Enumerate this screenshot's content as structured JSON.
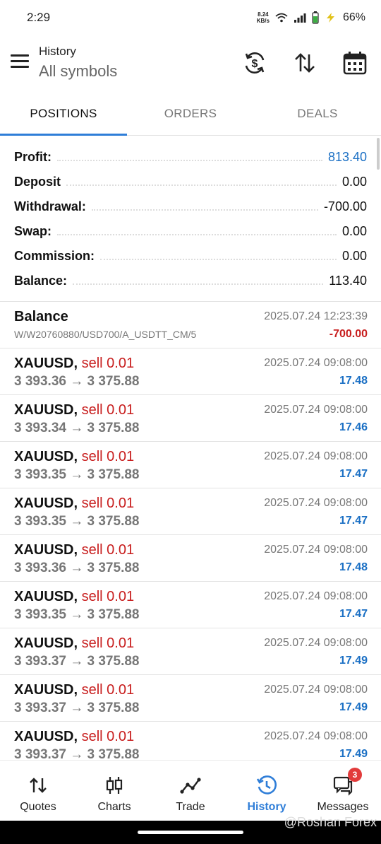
{
  "status_bar": {
    "time": "2:29",
    "net_speed_value": "8.24",
    "net_speed_unit": "KB/s",
    "battery": "66%"
  },
  "header": {
    "subtitle": "History",
    "title": "All symbols"
  },
  "tabs": [
    {
      "label": "POSITIONS",
      "active": true
    },
    {
      "label": "ORDERS",
      "active": false
    },
    {
      "label": "DEALS",
      "active": false
    }
  ],
  "summary": [
    {
      "label": "Profit:",
      "value": "813.40",
      "color": "#1a6fc4"
    },
    {
      "label": "Deposit",
      "value": "0.00"
    },
    {
      "label": "Withdrawal:",
      "value": "-700.00"
    },
    {
      "label": "Swap:",
      "value": "0.00"
    },
    {
      "label": "Commission:",
      "value": "0.00"
    },
    {
      "label": "Balance:",
      "value": "113.40"
    }
  ],
  "balance_entry": {
    "title": "Balance",
    "comment": "W/W20760880/USD700/A_USDTT_CM/5",
    "time": "2025.07.24 12:23:39",
    "amount": "-700.00"
  },
  "positions": [
    {
      "symbol": "XAUUSD,",
      "op": "sell 0.01",
      "prices": "3 393.36 → 3 375.88",
      "time": "2025.07.24 09:08:00",
      "profit": "17.48"
    },
    {
      "symbol": "XAUUSD,",
      "op": "sell 0.01",
      "prices": "3 393.34 → 3 375.88",
      "time": "2025.07.24 09:08:00",
      "profit": "17.46"
    },
    {
      "symbol": "XAUUSD,",
      "op": "sell 0.01",
      "prices": "3 393.35 → 3 375.88",
      "time": "2025.07.24 09:08:00",
      "profit": "17.47"
    },
    {
      "symbol": "XAUUSD,",
      "op": "sell 0.01",
      "prices": "3 393.35 → 3 375.88",
      "time": "2025.07.24 09:08:00",
      "profit": "17.47"
    },
    {
      "symbol": "XAUUSD,",
      "op": "sell 0.01",
      "prices": "3 393.36 → 3 375.88",
      "time": "2025.07.24 09:08:00",
      "profit": "17.48"
    },
    {
      "symbol": "XAUUSD,",
      "op": "sell 0.01",
      "prices": "3 393.35 → 3 375.88",
      "time": "2025.07.24 09:08:00",
      "profit": "17.47"
    },
    {
      "symbol": "XAUUSD,",
      "op": "sell 0.01",
      "prices": "3 393.37 → 3 375.88",
      "time": "2025.07.24 09:08:00",
      "profit": "17.49"
    },
    {
      "symbol": "XAUUSD,",
      "op": "sell 0.01",
      "prices": "3 393.37 → 3 375.88",
      "time": "2025.07.24 09:08:00",
      "profit": "17.49"
    },
    {
      "symbol": "XAUUSD,",
      "op": "sell 0.01",
      "prices": "3 393.37 → 3 375.88",
      "time": "2025.07.24 09:08:00",
      "profit": "17.49"
    }
  ],
  "bottom_nav": [
    {
      "label": "Quotes",
      "icon": "quotes-icon"
    },
    {
      "label": "Charts",
      "icon": "charts-icon"
    },
    {
      "label": "Trade",
      "icon": "trade-icon"
    },
    {
      "label": "History",
      "icon": "history-icon",
      "active": true
    },
    {
      "label": "Messages",
      "icon": "messages-icon",
      "badge": "3"
    }
  ],
  "watermark": "@Roshan Forex",
  "colors": {
    "accent": "#2f7ed8",
    "profit": "#1a6fc4",
    "sell": "#c81e1e"
  }
}
